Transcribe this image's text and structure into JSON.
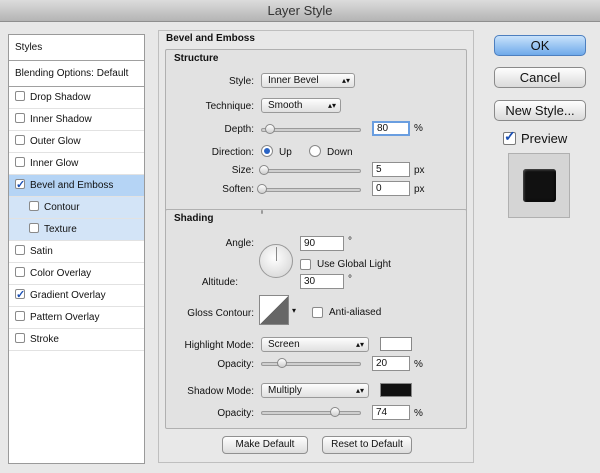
{
  "window": {
    "title": "Layer Style"
  },
  "styles_list": {
    "header": "Styles",
    "blending": "Blending Options: Default",
    "items": [
      {
        "label": "Drop Shadow",
        "checked": false
      },
      {
        "label": "Inner Shadow",
        "checked": false
      },
      {
        "label": "Outer Glow",
        "checked": false
      },
      {
        "label": "Inner Glow",
        "checked": false
      },
      {
        "label": "Bevel and Emboss",
        "checked": true,
        "selected": true
      },
      {
        "label": "Contour",
        "checked": false,
        "sub": true
      },
      {
        "label": "Texture",
        "checked": false,
        "sub": true
      },
      {
        "label": "Satin",
        "checked": false
      },
      {
        "label": "Color Overlay",
        "checked": false
      },
      {
        "label": "Gradient Overlay",
        "checked": true
      },
      {
        "label": "Pattern Overlay",
        "checked": false
      },
      {
        "label": "Stroke",
        "checked": false
      }
    ]
  },
  "panel": {
    "title": "Bevel and Emboss",
    "structure": {
      "title": "Structure",
      "style_label": "Style:",
      "style_value": "Inner Bevel",
      "technique_label": "Technique:",
      "technique_value": "Smooth",
      "depth_label": "Depth:",
      "depth_value": "80",
      "depth_unit": "%",
      "depth_slider_fraction": 0.08,
      "direction_label": "Direction:",
      "direction_up": "Up",
      "direction_down": "Down",
      "size_label": "Size:",
      "size_value": "5",
      "size_unit": "px",
      "soften_label": "Soften:",
      "soften_value": "0",
      "soften_unit": "px"
    },
    "shading": {
      "title": "Shading",
      "angle_label": "Angle:",
      "angle_value": "90",
      "angle_unit": "°",
      "global_light_label": "Use Global Light",
      "altitude_label": "Altitude:",
      "altitude_value": "30",
      "altitude_unit": "°",
      "gloss_label": "Gloss Contour:",
      "anti_aliased_label": "Anti-aliased",
      "highlight_mode_label": "Highlight Mode:",
      "highlight_mode_value": "Screen",
      "highlight_color": "#ffffff",
      "highlight_opacity_label": "Opacity:",
      "highlight_opacity_value": "20",
      "shadow_mode_label": "Shadow Mode:",
      "shadow_mode_value": "Multiply",
      "shadow_color": "#111111",
      "shadow_opacity_label": "Opacity:",
      "shadow_opacity_value": "74",
      "percent": "%"
    },
    "make_default": "Make Default",
    "reset_default": "Reset to Default"
  },
  "actions": {
    "ok": "OK",
    "cancel": "Cancel",
    "new_style": "New Style...",
    "preview": "Preview"
  }
}
